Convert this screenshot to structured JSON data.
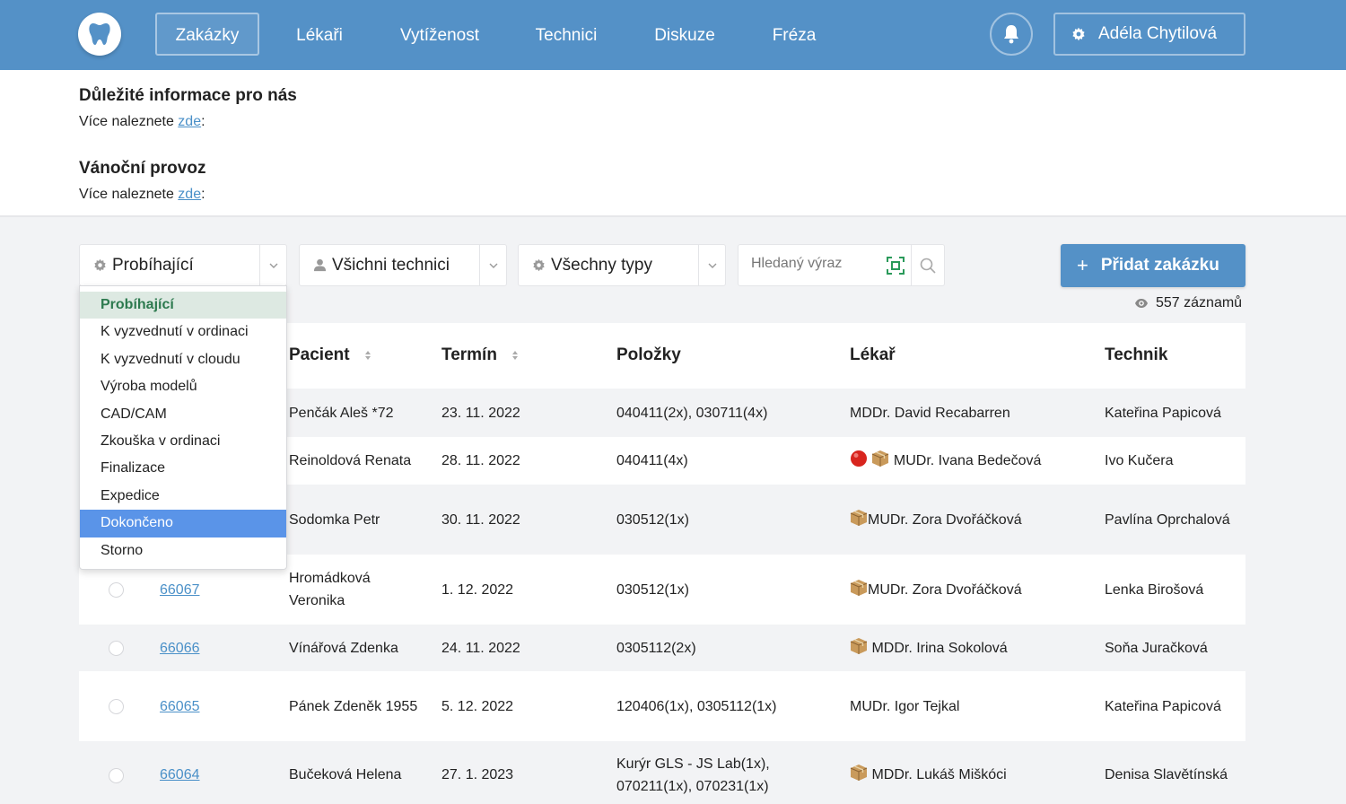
{
  "nav": {
    "items": [
      "Zakázky",
      "Lékaři",
      "Vytíženost",
      "Technici",
      "Diskuze",
      "Fréza"
    ],
    "active_index": 0,
    "user_name": "Adéla Chytilová"
  },
  "info": [
    {
      "title": "Důležité informace pro nás",
      "text": "Více naleznete ",
      "link": "zde",
      "suffix": ":"
    },
    {
      "title": "Vánoční provoz",
      "text": "Více naleznete ",
      "link": "zde",
      "suffix": ":"
    }
  ],
  "filters": {
    "status": "Probíhající",
    "technicians": "Všichni technici",
    "types": "Všechny typy",
    "search_placeholder": "Hledaný výraz"
  },
  "add_button": "Přidat zakázku",
  "record_count": "557 záznamů",
  "table": {
    "headers": [
      "Pacient",
      "Termín",
      "Položky",
      "Lékař",
      "Technik"
    ],
    "rows": [
      {
        "id": "",
        "patient": "Penčák Aleš *72",
        "date": "23. 11. 2022",
        "items": "040411(2x), 030711(4x)",
        "doctor": "MDDr. David Recabarren",
        "doctor_icons": "",
        "tech": "Kateřina Papicová"
      },
      {
        "id": "",
        "patient": "Reinoldová Renata",
        "date": "28. 11. 2022",
        "items": "040411(4x)",
        "doctor": "MUDr. Ivana Bedečová",
        "doctor_icons": "red-box",
        "tech": "Ivo Kučera"
      },
      {
        "id": "",
        "patient": "Sodomka Petr",
        "date": "30. 11. 2022",
        "items": "030512(1x)",
        "doctor": "MUDr. Zora Dvořáčková",
        "doctor_icons": "box-tight",
        "tech": "Pavlína Oprchalová"
      },
      {
        "id": "66067",
        "patient": "Hromádková Veronika",
        "date": "1. 12. 2022",
        "items": "030512(1x)",
        "doctor": "MUDr. Zora Dvořáčková",
        "doctor_icons": "box-tight",
        "tech": "Lenka Birošová"
      },
      {
        "id": "66066",
        "patient": "Vínářová Zdenka",
        "date": "24. 11. 2022",
        "items": "0305112(2x)",
        "doctor": "MDDr. Irina Sokolová",
        "doctor_icons": "box",
        "tech": "Soňa Juračková"
      },
      {
        "id": "66065",
        "patient": "Pánek Zdeněk 1955",
        "date": "5. 12. 2022",
        "items": "120406(1x), 0305112(1x)",
        "doctor": "MUDr. Igor Tejkal",
        "doctor_icons": "",
        "tech": "Kateřina Papicová"
      },
      {
        "id": "66064",
        "patient": "Bučeková Helena",
        "date": "27. 1. 2023",
        "items": "Kurýr GLS - JS Lab(1x), 070211(1x), 070231(1x)",
        "doctor": "MDDr. Lukáš Miškóci",
        "doctor_icons": "box",
        "tech": "Denisa Slavětínská"
      }
    ]
  },
  "dropdown": {
    "options": [
      "Probíhající",
      "K vyzvednutí v ordinaci",
      "K vyzvednutí v cloudu",
      "Výroba modelů",
      "CAD/CAM",
      "Zkouška v ordinaci",
      "Finalizace",
      "Expedice",
      "Dokončeno",
      "Storno"
    ],
    "current_index": 0,
    "hover_index": 8
  },
  "colors": {
    "primary": "#5491c7",
    "link": "#4a90c8",
    "dropdown_current_bg": "#dde9e2",
    "dropdown_current_text": "#2d7a4f",
    "dropdown_hover": "#5a94e8"
  },
  "icons": {
    "logo": "tooth-icon",
    "bell": "bell-icon",
    "user_gear": "gear-icon",
    "status_select": "gear-icon",
    "tech_select": "user-icon",
    "type_select": "gear-icon",
    "scan": "scan-icon",
    "search": "search-icon",
    "count": "eye-icon"
  }
}
